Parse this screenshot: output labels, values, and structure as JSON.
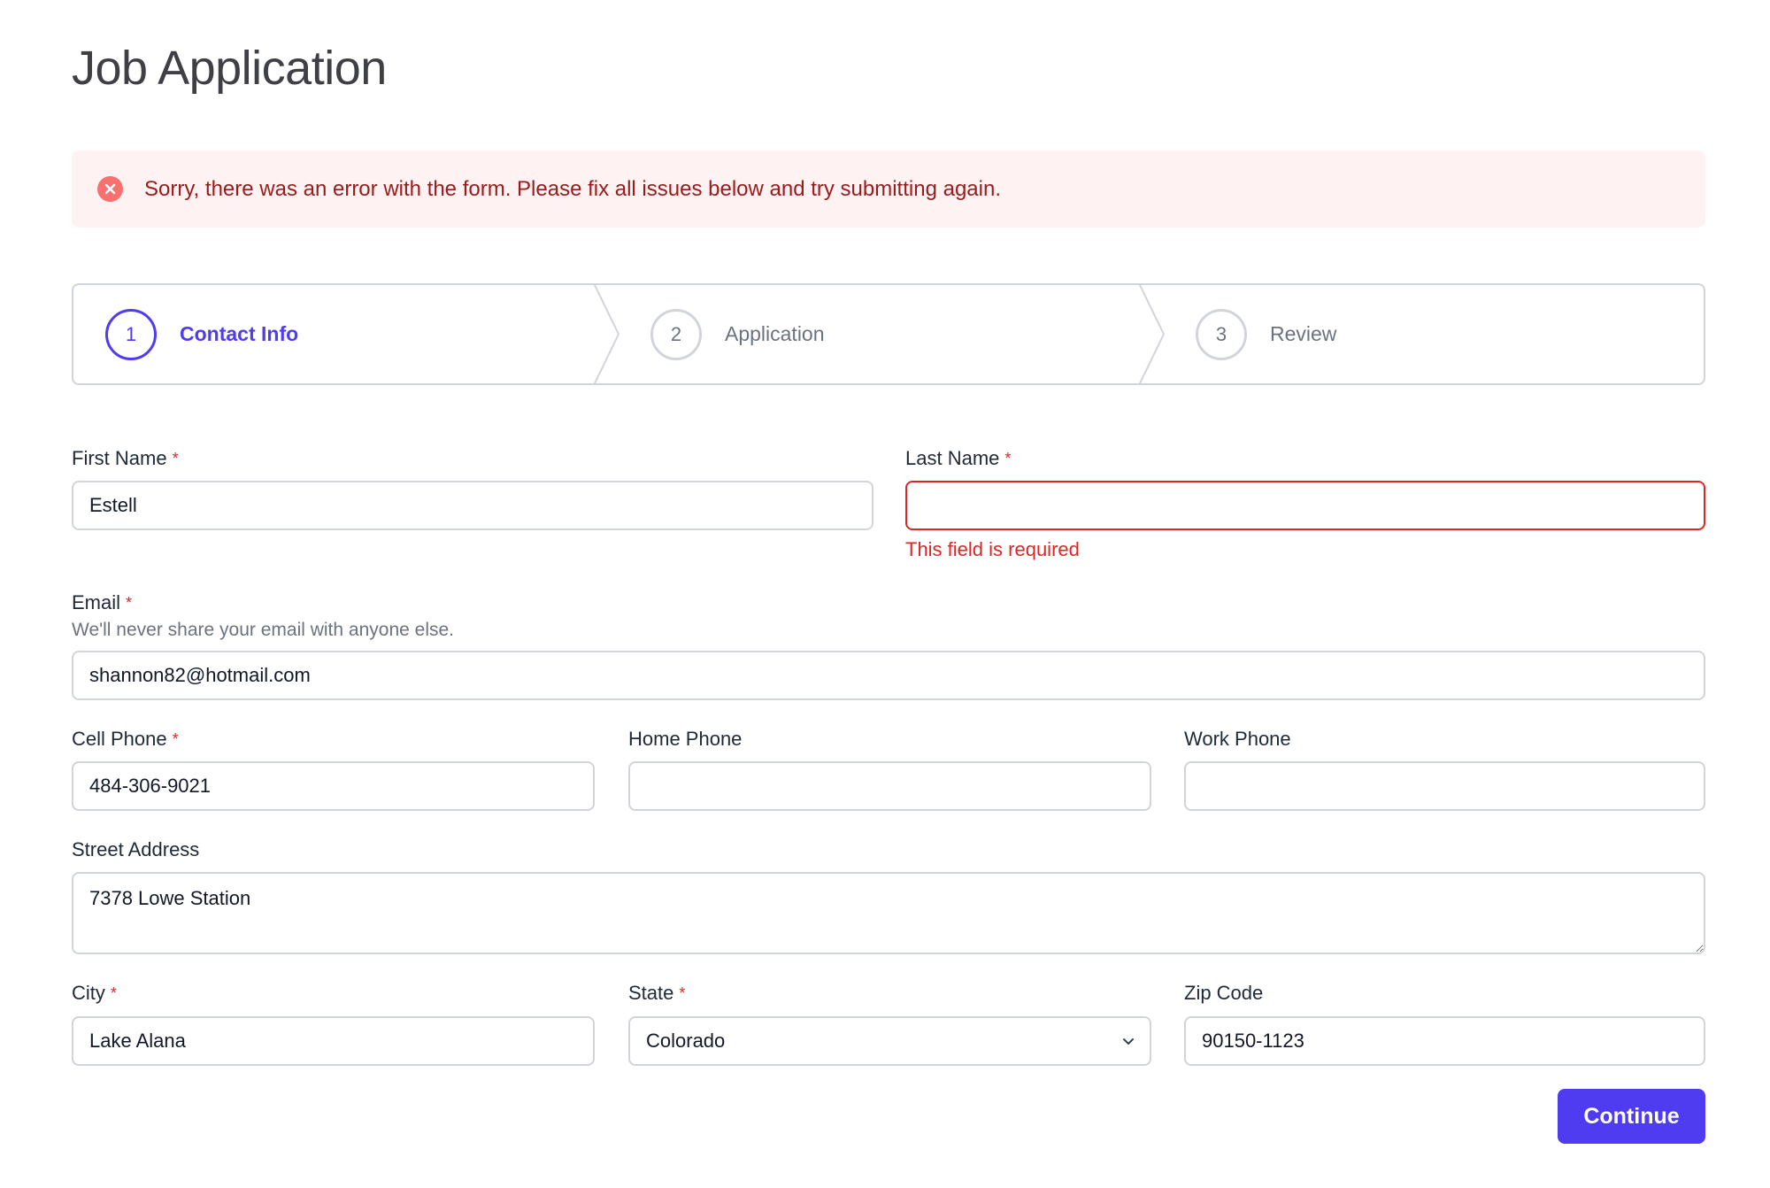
{
  "page": {
    "title": "Job Application"
  },
  "alert": {
    "message": "Sorry, there was an error with the form. Please fix all issues below and try submitting again.",
    "icon": "x-circle-icon",
    "color": "#991b1b"
  },
  "stepper": {
    "steps": [
      {
        "number": "1",
        "label": "Contact Info",
        "state": "current"
      },
      {
        "number": "2",
        "label": "Application",
        "state": "upcoming"
      },
      {
        "number": "3",
        "label": "Review",
        "state": "upcoming"
      }
    ]
  },
  "form": {
    "required_marker": "*",
    "first_name": {
      "label": "First Name",
      "value": "Estell",
      "required": true
    },
    "last_name": {
      "label": "Last Name",
      "value": "",
      "required": true,
      "error": "This field is required"
    },
    "email": {
      "label": "Email",
      "help": "We'll never share your email with anyone else.",
      "value": "shannon82@hotmail.com",
      "required": true
    },
    "cell_phone": {
      "label": "Cell Phone",
      "value": "484-306-9021",
      "required": true
    },
    "home_phone": {
      "label": "Home Phone",
      "value": "",
      "required": false
    },
    "work_phone": {
      "label": "Work Phone",
      "value": "",
      "required": false
    },
    "street_address": {
      "label": "Street Address",
      "value": "7378 Lowe Station",
      "required": false
    },
    "city": {
      "label": "City",
      "value": "Lake Alana",
      "required": true
    },
    "state": {
      "label": "State",
      "value": "Colorado",
      "required": true
    },
    "zip": {
      "label": "Zip Code",
      "value": "90150-1123",
      "required": false
    },
    "continue_label": "Continue"
  },
  "colors": {
    "accent": "#4f3cf0",
    "error": "#dc2626",
    "alert_bg": "#fef2f2",
    "border": "#d1d5db"
  }
}
